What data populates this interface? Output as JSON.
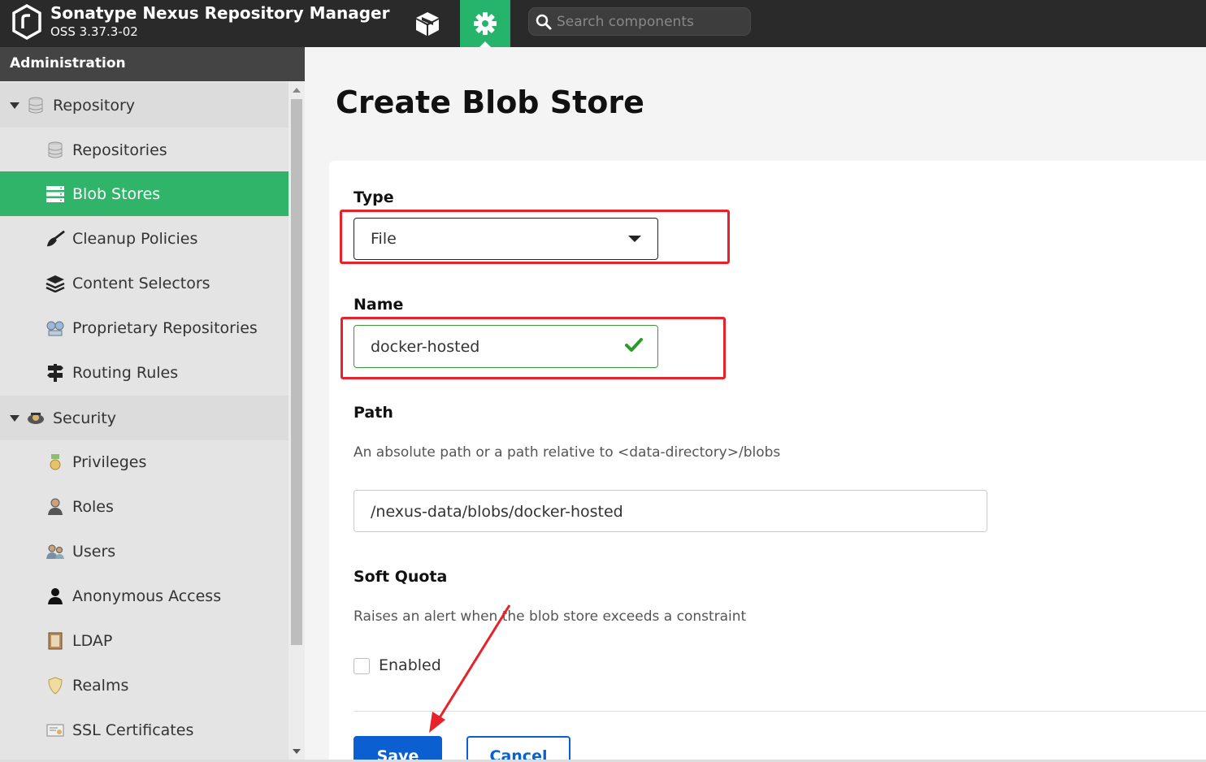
{
  "header": {
    "app_title": "Sonatype Nexus Repository Manager",
    "version": "OSS 3.37.3-02",
    "search_placeholder": "Search components",
    "accent_color": "#26b36b"
  },
  "sidebar": {
    "title": "Administration",
    "items": [
      {
        "label": "Repository",
        "icon": "database-icon",
        "type": "group"
      },
      {
        "label": "Repositories",
        "icon": "database-icon",
        "type": "child"
      },
      {
        "label": "Blob Stores",
        "icon": "server-icon",
        "type": "child",
        "active": true
      },
      {
        "label": "Cleanup Policies",
        "icon": "broom-icon",
        "type": "child"
      },
      {
        "label": "Content Selectors",
        "icon": "layers-icon",
        "type": "child"
      },
      {
        "label": "Proprietary Repositories",
        "icon": "network-icon",
        "type": "child"
      },
      {
        "label": "Routing Rules",
        "icon": "signpost-icon",
        "type": "child"
      },
      {
        "label": "Security",
        "icon": "security-icon",
        "type": "group"
      },
      {
        "label": "Privileges",
        "icon": "medal-icon",
        "type": "child"
      },
      {
        "label": "Roles",
        "icon": "role-icon",
        "type": "child"
      },
      {
        "label": "Users",
        "icon": "users-icon",
        "type": "child"
      },
      {
        "label": "Anonymous Access",
        "icon": "user-icon",
        "type": "child"
      },
      {
        "label": "LDAP",
        "icon": "book-icon",
        "type": "child"
      },
      {
        "label": "Realms",
        "icon": "shield-icon",
        "type": "child"
      },
      {
        "label": "SSL Certificates",
        "icon": "certificate-icon",
        "type": "child"
      }
    ]
  },
  "main": {
    "title": "Create Blob Store",
    "type_label": "Type",
    "type_value": "File",
    "name_label": "Name",
    "name_value": "docker-hosted",
    "path_label": "Path",
    "path_help": "An absolute path or a path relative to <data-directory>/blobs",
    "path_value": "/nexus-data/blobs/docker-hosted",
    "quota_label": "Soft Quota",
    "quota_help": "Raises an alert when the blob store exceeds a constraint",
    "enabled_label": "Enabled",
    "enabled_checked": false,
    "save_label": "Save",
    "cancel_label": "Cancel"
  }
}
